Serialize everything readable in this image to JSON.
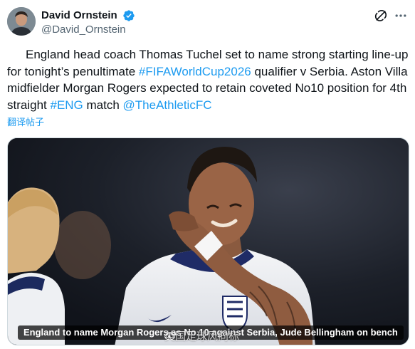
{
  "author": {
    "display_name": "David Ornstein",
    "handle": "@David_Ornstein",
    "verified": true,
    "verified_icon": "verified-badge-icon",
    "avatar_icon": "avatar"
  },
  "header_actions": {
    "grok_icon": "grok-icon",
    "more_icon": "more-dots-icon"
  },
  "tweet": {
    "text_1": "England head coach Thomas Tuchel set to name strong starting line-up for tonight’s penultimate ",
    "hashtag_1": "#FIFAWorldCup2026",
    "text_2": " qualifier v Serbia. Aston Villa midfielder Morgan Rogers expected to retain coveted No10 position for 4th straight ",
    "hashtag_2": "#ENG",
    "text_3": " match ",
    "mention_1": "@TheAthleticFC",
    "translate_label": "翻译帖子"
  },
  "media": {
    "caption": "England to name Morgan Rogers as No.10 against Serbia, Jude Bellingham on bench",
    "watermark": "英国足球风向标",
    "watermark_icon": "weibo-icon"
  },
  "colors": {
    "link": "#1d9bf0",
    "verified": "#1d9bf0",
    "text": "#0f1419",
    "secondary": "#536471"
  }
}
